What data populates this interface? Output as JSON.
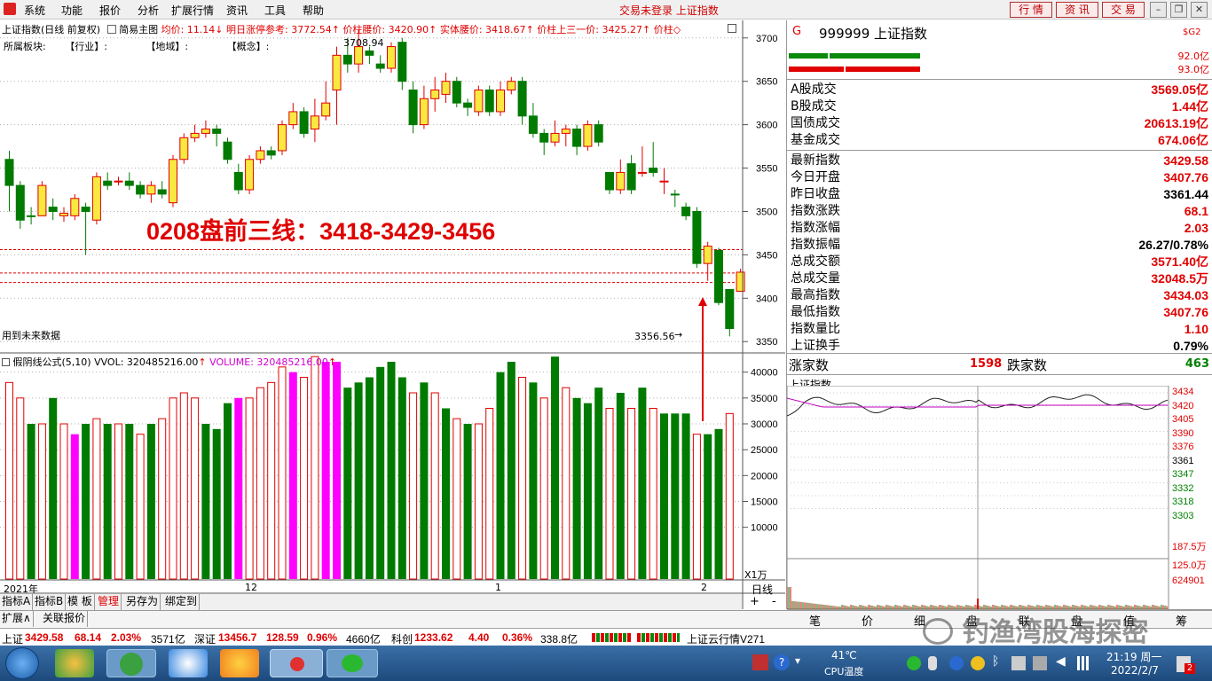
{
  "menu": {
    "system": "系统",
    "func": "功能",
    "report": "报价",
    "analysis": "分析",
    "ext": "扩展行情",
    "info": "资讯",
    "tools": "工具",
    "help": "帮助"
  },
  "status_title": "交易未登录  上证指数",
  "top_buttons": {
    "quote": "行 情",
    "news": "资 讯",
    "trade": "交 易"
  },
  "chart_header": {
    "name": "上证指数(日线 前复权)",
    "template": "简易主图",
    "avg": "均价: 11.14",
    "ref": "明日涨停参考: 3772.54",
    "waist": "价柱腰价: 3420.90",
    "body_waist": "实体腰价: 3418.67",
    "upper_third": "价柱上三一价: 3425.27",
    "price_col": "价柱"
  },
  "board_line": {
    "label": "所属板块:",
    "industry": "【行业】:",
    "region": "【地域】:",
    "concept": "【概念】:"
  },
  "annotation": "0208盘前三线：3418-3429-3456",
  "future_note": "用到未来数据",
  "high_label": "3708.94",
  "low_label": "3356.56",
  "price_axis": [
    "3700",
    "3650",
    "3600",
    "3550",
    "3500",
    "3450",
    "3400",
    "3350"
  ],
  "vol_header": {
    "formula": "假阴线公式(5,10)",
    "vvol": "VVOL: 320485216.00",
    "volume": "VOLUME: 320485216.00"
  },
  "vol_axis": [
    "40000",
    "35000",
    "30000",
    "25000",
    "20000",
    "15000",
    "10000"
  ],
  "vol_unit": "X1万",
  "date_axis": {
    "d2021": "2021年",
    "d12": "12",
    "d1": "1",
    "d2": "2",
    "period": "日线"
  },
  "chart_data": {
    "type": "candlestick",
    "price_range": [
      3340,
      3710
    ],
    "support_lines": [
      3418,
      3429,
      3456
    ],
    "volume_range": [
      0,
      42000
    ],
    "candles": [
      [
        3560,
        3530,
        3570,
        3500,
        "g"
      ],
      [
        3530,
        3490,
        3535,
        3480,
        "g"
      ],
      [
        3495,
        3495,
        3505,
        3485,
        "g"
      ],
      [
        3495,
        3530,
        3535,
        3495,
        "r"
      ],
      [
        3505,
        3500,
        3515,
        3490,
        "g"
      ],
      [
        3495,
        3498,
        3505,
        3488,
        "r"
      ],
      [
        3495,
        3515,
        3520,
        3490,
        "r"
      ],
      [
        3505,
        3500,
        3510,
        3450,
        "g"
      ],
      [
        3490,
        3540,
        3545,
        3485,
        "r"
      ],
      [
        3535,
        3530,
        3545,
        3525,
        "g"
      ],
      [
        3535,
        3535,
        3540,
        3530,
        "r"
      ],
      [
        3535,
        3530,
        3545,
        3525,
        "g"
      ],
      [
        3530,
        3520,
        3535,
        3515,
        "g"
      ],
      [
        3520,
        3530,
        3535,
        3510,
        "r"
      ],
      [
        3525,
        3520,
        3535,
        3515,
        "g"
      ],
      [
        3510,
        3560,
        3565,
        3505,
        "r"
      ],
      [
        3560,
        3585,
        3590,
        3555,
        "r"
      ],
      [
        3585,
        3590,
        3600,
        3580,
        "r"
      ],
      [
        3590,
        3595,
        3605,
        3585,
        "r"
      ],
      [
        3595,
        3590,
        3600,
        3575,
        "g"
      ],
      [
        3580,
        3560,
        3585,
        3555,
        "g"
      ],
      [
        3545,
        3525,
        3555,
        3520,
        "g"
      ],
      [
        3525,
        3560,
        3565,
        3520,
        "r"
      ],
      [
        3560,
        3570,
        3575,
        3555,
        "r"
      ],
      [
        3570,
        3565,
        3575,
        3560,
        "g"
      ],
      [
        3570,
        3600,
        3605,
        3565,
        "r"
      ],
      [
        3600,
        3615,
        3625,
        3595,
        "r"
      ],
      [
        3615,
        3590,
        3620,
        3585,
        "g"
      ],
      [
        3595,
        3610,
        3630,
        3580,
        "r"
      ],
      [
        3610,
        3625,
        3650,
        3605,
        "r"
      ],
      [
        3640,
        3680,
        3690,
        3600,
        "r"
      ],
      [
        3680,
        3670,
        3700,
        3660,
        "g"
      ],
      [
        3670,
        3690,
        3709,
        3660,
        "r"
      ],
      [
        3685,
        3680,
        3690,
        3670,
        "g"
      ],
      [
        3670,
        3665,
        3680,
        3660,
        "g"
      ],
      [
        3665,
        3690,
        3695,
        3660,
        "r"
      ],
      [
        3695,
        3650,
        3700,
        3640,
        "g"
      ],
      [
        3640,
        3600,
        3650,
        3590,
        "g"
      ],
      [
        3600,
        3630,
        3645,
        3595,
        "r"
      ],
      [
        3630,
        3640,
        3655,
        3615,
        "r"
      ],
      [
        3635,
        3650,
        3660,
        3625,
        "r"
      ],
      [
        3650,
        3625,
        3655,
        3620,
        "g"
      ],
      [
        3625,
        3620,
        3630,
        3610,
        "g"
      ],
      [
        3615,
        3640,
        3645,
        3610,
        "r"
      ],
      [
        3640,
        3615,
        3645,
        3610,
        "g"
      ],
      [
        3615,
        3640,
        3650,
        3610,
        "r"
      ],
      [
        3640,
        3650,
        3655,
        3635,
        "r"
      ],
      [
        3650,
        3610,
        3655,
        3600,
        "g"
      ],
      [
        3610,
        3590,
        3625,
        3585,
        "g"
      ],
      [
        3590,
        3580,
        3595,
        3565,
        "g"
      ],
      [
        3580,
        3590,
        3605,
        3575,
        "r"
      ],
      [
        3590,
        3595,
        3600,
        3575,
        "r"
      ],
      [
        3595,
        3575,
        3600,
        3565,
        "g"
      ],
      [
        3575,
        3600,
        3605,
        3570,
        "r"
      ],
      [
        3600,
        3580,
        3605,
        3575,
        "g"
      ],
      [
        3545,
        3525,
        3545,
        3520,
        "g"
      ],
      [
        3525,
        3545,
        3560,
        3520,
        "r"
      ],
      [
        3555,
        3525,
        3565,
        3520,
        "g"
      ],
      [
        3545,
        3545,
        3575,
        3540,
        "r"
      ],
      [
        3550,
        3545,
        3580,
        3540,
        "g"
      ],
      [
        3535,
        3535,
        3550,
        3520,
        "r"
      ],
      [
        3520,
        3520,
        3525,
        3505,
        "g"
      ],
      [
        3505,
        3495,
        3510,
        3490,
        "g"
      ],
      [
        3500,
        3440,
        3505,
        3435,
        "g"
      ],
      [
        3440,
        3460,
        3465,
        3420,
        "r"
      ],
      [
        3455,
        3395,
        3458,
        3392,
        "g"
      ],
      [
        3410,
        3365,
        3410,
        3356,
        "g"
      ],
      [
        3408,
        3430,
        3434,
        3408,
        "r"
      ]
    ],
    "volumes": [
      [
        38000,
        "r"
      ],
      [
        35000,
        "r"
      ],
      [
        30000,
        "g"
      ],
      [
        30000,
        "r"
      ],
      [
        35000,
        "g"
      ],
      [
        30000,
        "r"
      ],
      [
        28000,
        "m"
      ],
      [
        30000,
        "g"
      ],
      [
        31000,
        "r"
      ],
      [
        30000,
        "g"
      ],
      [
        30000,
        "r"
      ],
      [
        30000,
        "g"
      ],
      [
        28000,
        "r"
      ],
      [
        30000,
        "g"
      ],
      [
        31000,
        "r"
      ],
      [
        35000,
        "r"
      ],
      [
        36000,
        "r"
      ],
      [
        35000,
        "r"
      ],
      [
        30000,
        "g"
      ],
      [
        29000,
        "g"
      ],
      [
        34000,
        "g"
      ],
      [
        35000,
        "m"
      ],
      [
        35000,
        "r"
      ],
      [
        37000,
        "r"
      ],
      [
        38000,
        "r"
      ],
      [
        41000,
        "r"
      ],
      [
        40000,
        "m"
      ],
      [
        39000,
        "r"
      ],
      [
        43000,
        "r"
      ],
      [
        42000,
        "m"
      ],
      [
        42000,
        "m"
      ],
      [
        37000,
        "g"
      ],
      [
        38000,
        "g"
      ],
      [
        39000,
        "g"
      ],
      [
        41000,
        "g"
      ],
      [
        42000,
        "g"
      ],
      [
        39000,
        "g"
      ],
      [
        36000,
        "r"
      ],
      [
        38000,
        "g"
      ],
      [
        36000,
        "r"
      ],
      [
        33000,
        "g"
      ],
      [
        31000,
        "r"
      ],
      [
        30000,
        "g"
      ],
      [
        30000,
        "r"
      ],
      [
        33000,
        "r"
      ],
      [
        40000,
        "g"
      ],
      [
        42000,
        "g"
      ],
      [
        39000,
        "r"
      ],
      [
        38000,
        "g"
      ],
      [
        35000,
        "r"
      ],
      [
        43000,
        "g"
      ],
      [
        37000,
        "r"
      ],
      [
        35000,
        "g"
      ],
      [
        34000,
        "g"
      ],
      [
        37000,
        "g"
      ],
      [
        33000,
        "r"
      ],
      [
        36000,
        "g"
      ],
      [
        33000,
        "r"
      ],
      [
        37000,
        "g"
      ],
      [
        33000,
        "r"
      ],
      [
        32000,
        "g"
      ],
      [
        32000,
        "g"
      ],
      [
        32000,
        "g"
      ],
      [
        28000,
        "r"
      ],
      [
        28000,
        "g"
      ],
      [
        29000,
        "g"
      ],
      [
        32000,
        "r"
      ]
    ]
  },
  "right": {
    "badge": "G",
    "code_name": "999999 上证指数",
    "sg": "$G2",
    "flow1": "92.0亿",
    "flow2": "93.0亿",
    "rows": [
      {
        "label": "A股成交",
        "value": "3569.05亿",
        "c": "red"
      },
      {
        "label": "B股成交",
        "value": "1.44亿",
        "c": "red"
      },
      {
        "label": "国债成交",
        "value": "20613.19亿",
        "c": "red"
      },
      {
        "label": "基金成交",
        "value": "674.06亿",
        "c": "red"
      },
      {
        "label": "最新指数",
        "value": "3429.58",
        "c": "red"
      },
      {
        "label": "今日开盘",
        "value": "3407.76",
        "c": "red"
      },
      {
        "label": "昨日收盘",
        "value": "3361.44",
        "c": "blk"
      },
      {
        "label": "指数涨跌",
        "value": "68.1",
        "c": "red"
      },
      {
        "label": "指数涨幅",
        "value": "2.03",
        "c": "red"
      },
      {
        "label": "指数振幅",
        "value": "26.27/0.78%",
        "c": "blk"
      },
      {
        "label": "总成交额",
        "value": "3571.40亿",
        "c": "red"
      },
      {
        "label": "总成交量",
        "value": "32048.5万",
        "c": "red"
      },
      {
        "label": "最高指数",
        "value": "3434.03",
        "c": "red"
      },
      {
        "label": "最低指数",
        "value": "3407.76",
        "c": "red"
      },
      {
        "label": "指数量比",
        "value": "1.10",
        "c": "red"
      },
      {
        "label": "上证换手",
        "value": "0.79%",
        "c": "blk"
      }
    ],
    "up_label": "涨家数",
    "up_count": "1598",
    "down_label": "跌家数",
    "down_count": "463",
    "mini_title": "上证指数",
    "mini_axis": [
      {
        "v": "3434",
        "c": "red"
      },
      {
        "v": "3420",
        "c": "red"
      },
      {
        "v": "3405",
        "c": "red"
      },
      {
        "v": "3390",
        "c": "red"
      },
      {
        "v": "3376",
        "c": "red"
      },
      {
        "v": "3361",
        "c": "blk"
      },
      {
        "v": "3347",
        "c": "grn"
      },
      {
        "v": "3332",
        "c": "grn"
      },
      {
        "v": "3318",
        "c": "grn"
      },
      {
        "v": "3303",
        "c": "grn"
      },
      {
        "v": "187.5万",
        "c": "red"
      },
      {
        "v": "125.0万",
        "c": "red"
      },
      {
        "v": "624901",
        "c": "red"
      }
    ],
    "bottom_tabs": [
      "笔",
      "价",
      "细",
      "盘",
      "联",
      "盘",
      "值",
      "筹"
    ]
  },
  "bottom_tabs": [
    "指标A",
    "指标B",
    "模 板",
    "管理",
    "另存为",
    "绑定到"
  ],
  "bottom_tabs2": [
    "扩展∧",
    "关联报价"
  ],
  "ticker": {
    "sh_label": "上证",
    "sh_price": "3429.58",
    "sh_chg": "68.14",
    "sh_pct": "2.03%",
    "sh_amt": "3571亿",
    "sz_label": "深证",
    "sz_price": "13456.7",
    "sz_chg": "128.59",
    "sz_pct": "0.96%",
    "sz_amt": "4660亿",
    "kc_label": "科创",
    "kc_price": "1233.62",
    "kc_chg": "4.40",
    "kc_pct": "0.36%",
    "kc_amt": "338.8亿",
    "cloud": "上证云行情V271"
  },
  "watermark": "钓渔湾股海探密",
  "taskbar": {
    "temp": "41℃",
    "cpu": "CPU温度",
    "time": "21:19 周一",
    "date": "2022/2/7",
    "badge": "2"
  }
}
